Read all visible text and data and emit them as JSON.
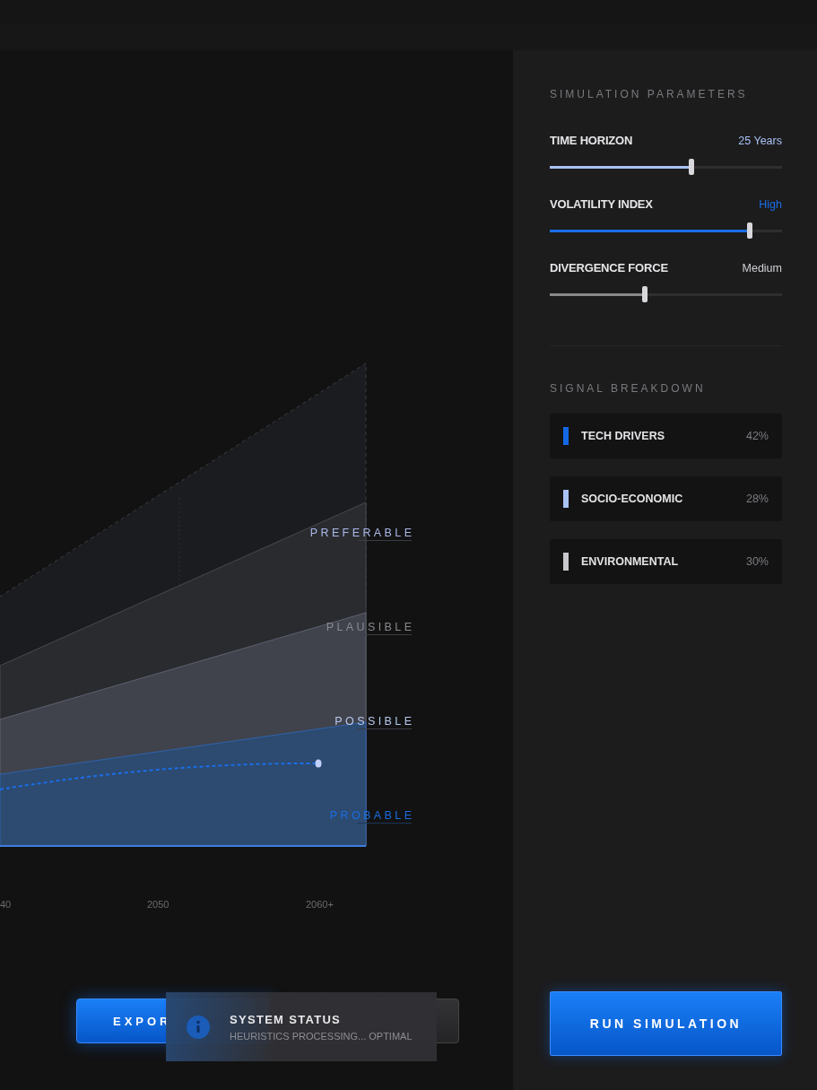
{
  "chart": {
    "bands": [
      {
        "label": "PREFERABLE",
        "kind": "preferable"
      },
      {
        "label": "PLAUSIBLE",
        "kind": "plausible"
      },
      {
        "label": "POSSIBLE",
        "kind": "possible"
      },
      {
        "label": "PROBABLE",
        "kind": "probable"
      }
    ],
    "x_labels": [
      "40",
      "2050",
      "2060+"
    ]
  },
  "actions": [
    {
      "label": "EXPOR",
      "kind": "primary"
    },
    {
      "kind": "secondary"
    }
  ],
  "toast": {
    "title": "SYSTEM STATUS",
    "message": "HEURISTICS PROCESSING... OPTIMAL"
  },
  "panel": {
    "parameters_title": "SIMULATION PARAMETERS",
    "parameters": [
      {
        "name": "TIME HORIZON",
        "reading": "25 Years",
        "level": 0.61,
        "color": "#a9c2f5"
      },
      {
        "name": "VOLATILITY INDEX",
        "reading": "High",
        "level": 0.86,
        "color": "#1a6fe8"
      },
      {
        "name": "DIVERGENCE FORCE",
        "reading": "Medium",
        "level": 0.41,
        "color": "#8a8a8d"
      }
    ],
    "signals_title": "SIGNAL BREAKDOWN",
    "signals": [
      {
        "name": "TECH DRIVERS",
        "share": "42%",
        "color": "#1468e6"
      },
      {
        "name": "SOCIO-ECONOMIC",
        "share": "28%",
        "color": "#a9c2f5"
      },
      {
        "name": "ENVIRONMENTAL",
        "share": "30%",
        "color": "#c8c8cc"
      }
    ],
    "run_button": "RUN SIMULATION"
  }
}
